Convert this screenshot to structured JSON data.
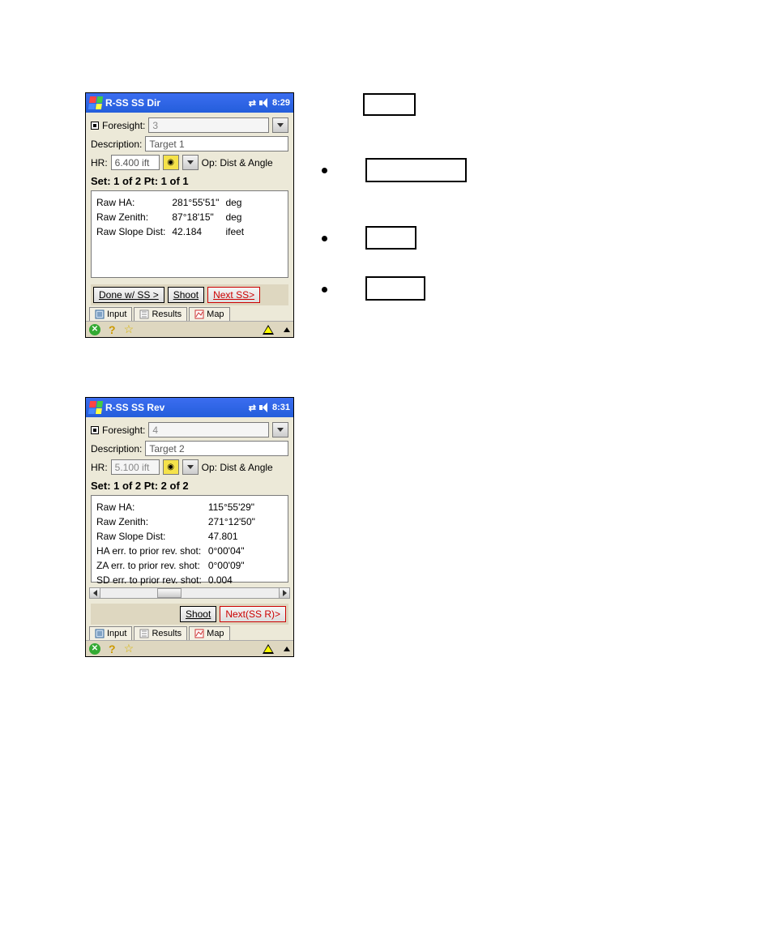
{
  "top": {
    "title": "R-SS SS Dir",
    "time": "8:29",
    "foresight_label": "Foresight:",
    "foresight_value": "3",
    "description_label": "Description:",
    "description_value": "Target 1",
    "hr_label": "HR:",
    "hr_value": "6.400 ift",
    "op_label": "Op: Dist & Angle",
    "set_label": "Set: 1 of 2  Pt: 1 of 1",
    "rows": [
      {
        "k": "Raw HA:",
        "v": "281°55'51\"",
        "u": "deg"
      },
      {
        "k": "Raw Zenith:",
        "v": "87°18'15\"",
        "u": "deg"
      },
      {
        "k": "Raw Slope Dist:",
        "v": "42.184",
        "u": "ifeet"
      }
    ],
    "done_btn": "Done w/ SS >",
    "shoot_btn": "Shoot",
    "next_btn": "Next SS>"
  },
  "bottom": {
    "title": "R-SS SS Rev",
    "time": "8:31",
    "foresight_label": "Foresight:",
    "foresight_value": "4",
    "description_label": "Description:",
    "description_value": "Target 2",
    "hr_label": "HR:",
    "hr_value": "5.100 ift",
    "op_label": "Op: Dist & Angle",
    "set_label": "Set: 1 of 2  Pt: 2 of 2",
    "rows": [
      {
        "k": "Raw HA:",
        "v": "115°55'29\""
      },
      {
        "k": "Raw Zenith:",
        "v": "271°12'50\""
      },
      {
        "k": "Raw Slope Dist:",
        "v": "47.801"
      },
      {
        "k": "HA err. to prior rev. shot:",
        "v": "0°00'04\""
      },
      {
        "k": "ZA err. to prior rev. shot:",
        "v": "0°00'09\""
      },
      {
        "k": "SD err. to prior rev. shot:",
        "v": "0.004"
      }
    ],
    "shoot_btn": "Shoot",
    "next_btn": "Next(SS R)>"
  },
  "tabs": {
    "input": "Input",
    "results": "Results",
    "map": "Map"
  }
}
